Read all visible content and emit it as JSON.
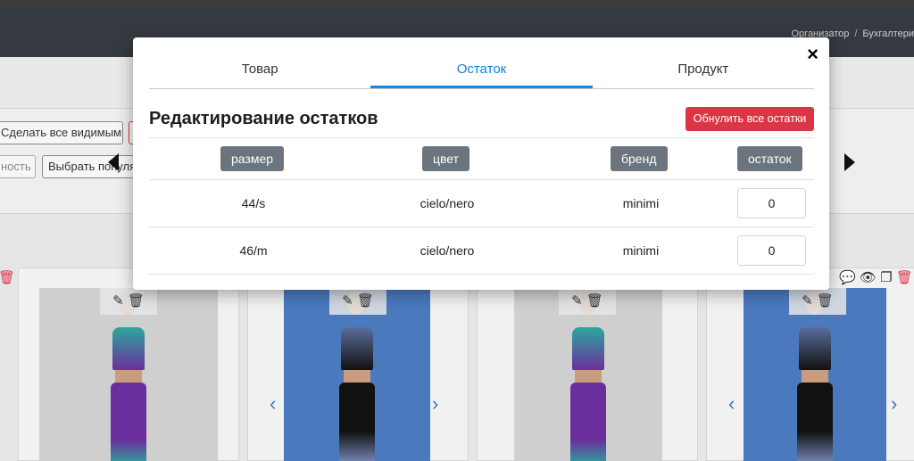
{
  "background": {
    "breadcrumbs": [
      "Организатор",
      "Бухгалтери"
    ],
    "toolbar": {
      "make_visible_label": "Сделать все видимыми",
      "partial_label": "ность",
      "select_label": "Выбрать популя"
    }
  },
  "modal": {
    "close_glyph": "×",
    "tabs": [
      {
        "label": "Товар",
        "active": false
      },
      {
        "label": "Остаток",
        "active": true
      },
      {
        "label": "Продукт",
        "active": false
      }
    ],
    "title": "Редактирование остатков",
    "reset_label": "Обнулить все остатки",
    "columns": [
      "размер",
      "цвет",
      "бренд",
      "остаток"
    ],
    "rows": [
      {
        "size": "44/s",
        "color": "cielo/nero",
        "brand": "minimi",
        "stock": "0"
      },
      {
        "size": "46/m",
        "color": "cielo/nero",
        "brand": "minimi",
        "stock": "0"
      }
    ]
  },
  "colors": {
    "accent": "#1a87e0",
    "danger": "#dc3545",
    "header_pill": "#6c757d",
    "navbar": "#343a40"
  }
}
